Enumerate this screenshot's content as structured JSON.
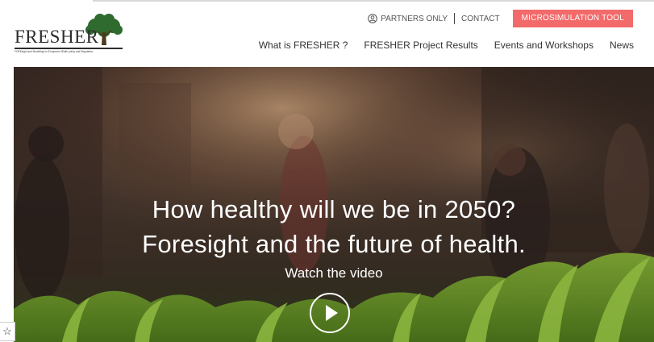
{
  "logo": {
    "name": "FRESHER",
    "tagline": "FOREsight and Modelling for European HEalth policy and Regulation"
  },
  "util_nav": {
    "partners": "PARTNERS ONLY",
    "contact": "CONTACT",
    "microsim": "MICROSIMULATION TOOL"
  },
  "main_nav": {
    "items": [
      "What is FRESHER ?",
      "FRESHER Project Results",
      "Events and Workshops",
      "News"
    ]
  },
  "hero": {
    "headline_1": "How healthy will we be in 2050?",
    "headline_2": "Foresight and the future of health.",
    "watch": "Watch the video"
  },
  "bookmark": {
    "icon": "star-icon",
    "glyph": "☆"
  },
  "colors": {
    "accent": "#f26a6a",
    "logo_green": "#2f6b2f",
    "nav_text": "#333333"
  }
}
